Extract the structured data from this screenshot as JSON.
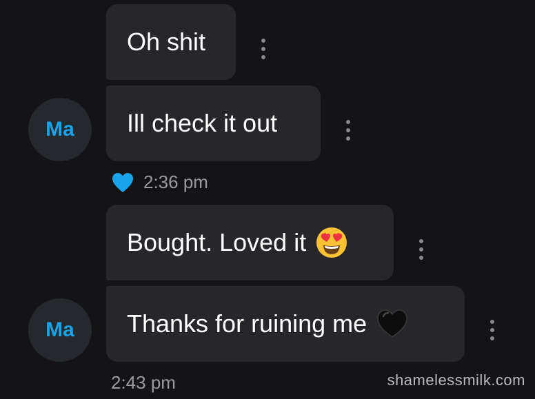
{
  "colors": {
    "background": "#141417",
    "bubble": "#27272b",
    "accent": "#19a3e8",
    "meta_text": "#9a9ba1"
  },
  "messages": [
    {
      "text": "Oh shit",
      "menu_icon": "more-vertical-icon"
    },
    {
      "text": "Ill check it out",
      "menu_icon": "more-vertical-icon"
    },
    {
      "text": "Bought. Loved it",
      "emoji": "heart-eyes-emoji",
      "menu_icon": "more-vertical-icon"
    },
    {
      "text": "Thanks for ruining me",
      "emoji": "black-heart-emoji",
      "menu_icon": "more-vertical-icon"
    }
  ],
  "avatars": [
    {
      "initials": "Ma"
    },
    {
      "initials": "Ma"
    }
  ],
  "groups": [
    {
      "liked": true,
      "like_icon": "heart-icon",
      "time": "2:36 pm"
    },
    {
      "liked": false,
      "time": "2:43 pm"
    }
  ],
  "watermark": "shamelessmilk.com"
}
